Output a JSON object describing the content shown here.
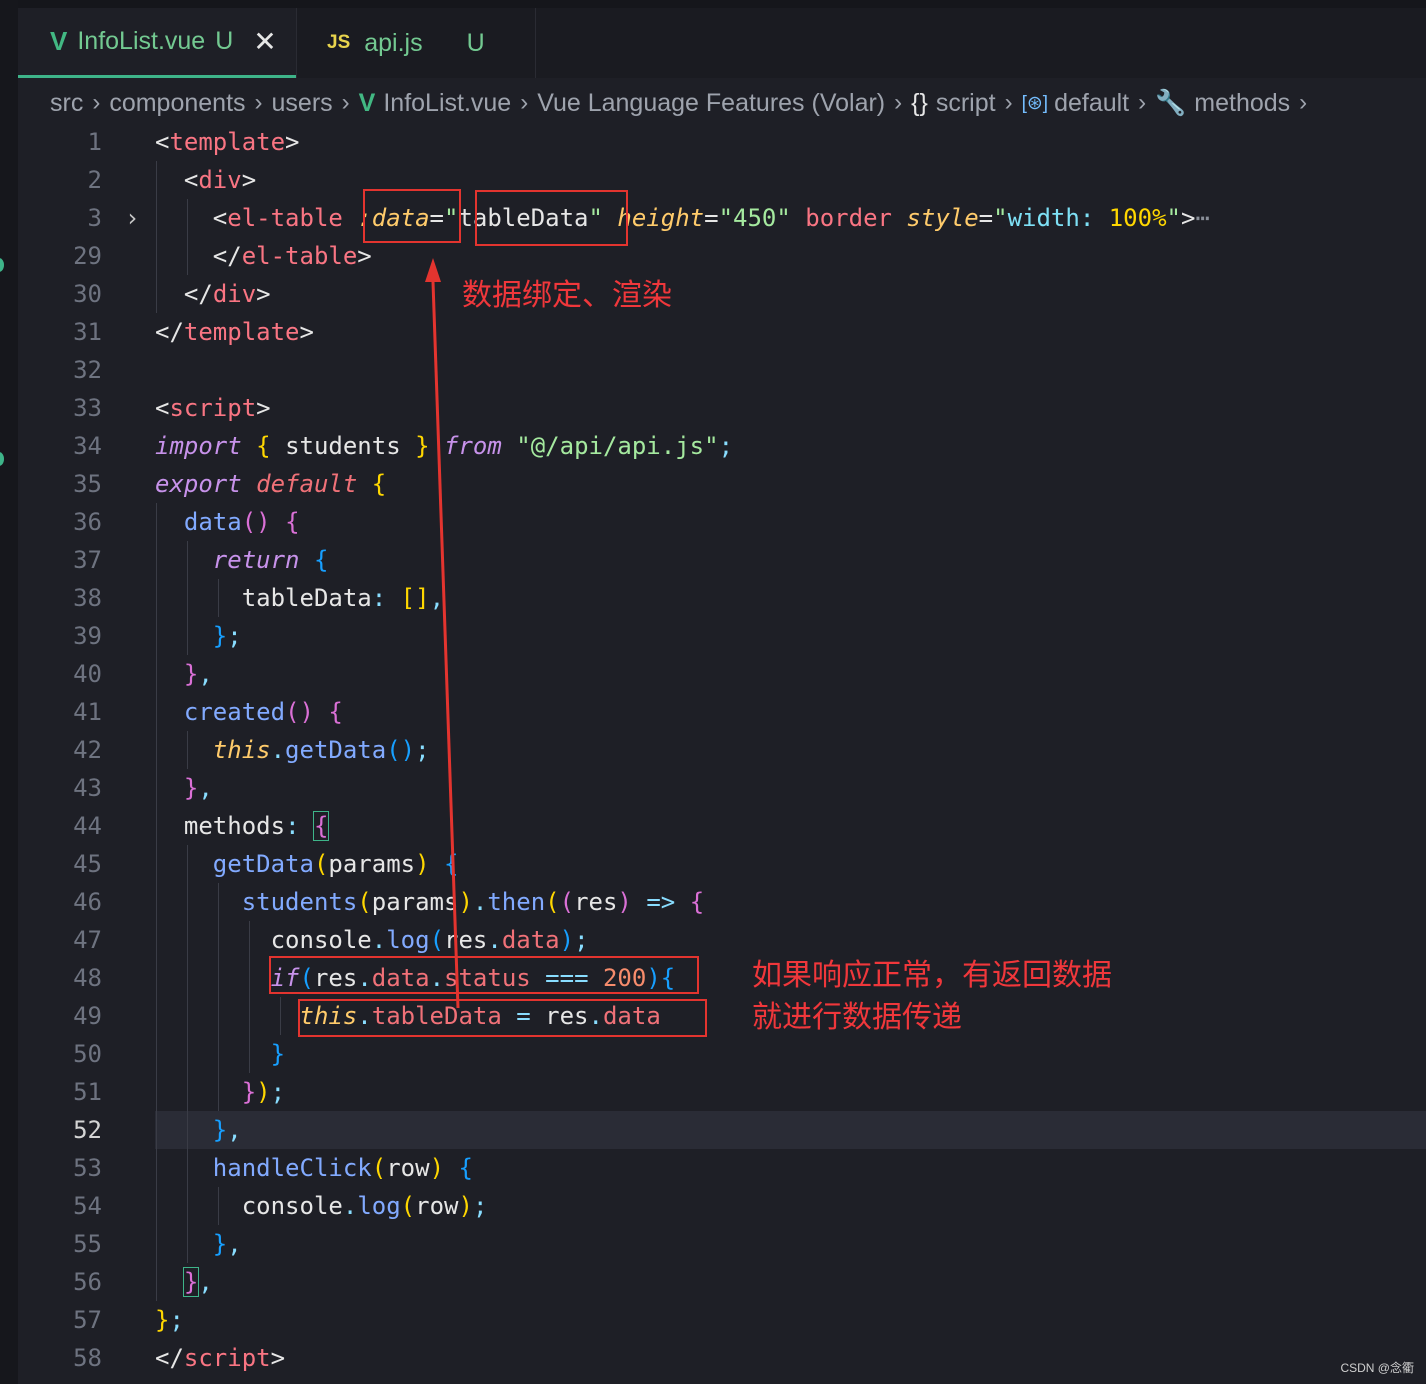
{
  "tabs": [
    {
      "icon": "V",
      "name": "InfoList.vue",
      "status": "U",
      "close": "✕"
    },
    {
      "icon": "JS",
      "name": "api.js",
      "status": "U"
    }
  ],
  "breadcrumb": {
    "items": [
      "src",
      "components",
      "users",
      "InfoList.vue",
      "Vue Language Features (Volar)",
      "script",
      "default",
      "methods"
    ],
    "separator": "›"
  },
  "code": {
    "line_numbers": [
      "1",
      "2",
      "3",
      "29",
      "30",
      "31",
      "32",
      "33",
      "34",
      "35",
      "36",
      "37",
      "38",
      "39",
      "40",
      "41",
      "42",
      "43",
      "44",
      "45",
      "46",
      "47",
      "48",
      "49",
      "50",
      "51",
      "52",
      "53",
      "54",
      "55",
      "56",
      "57",
      "58"
    ],
    "current_line": "52"
  },
  "annotations": {
    "binding_note": "数据绑定、渲染",
    "response_note_line1": "如果响应正常，有返回数据",
    "response_note_line2": "就进行数据传递"
  },
  "watermark": "CSDN @念衢",
  "colors": {
    "annotation_red": "#e3342f",
    "vue_green": "#42b883",
    "js_yellow": "#e8d44d",
    "modified_green": "#73c991"
  }
}
